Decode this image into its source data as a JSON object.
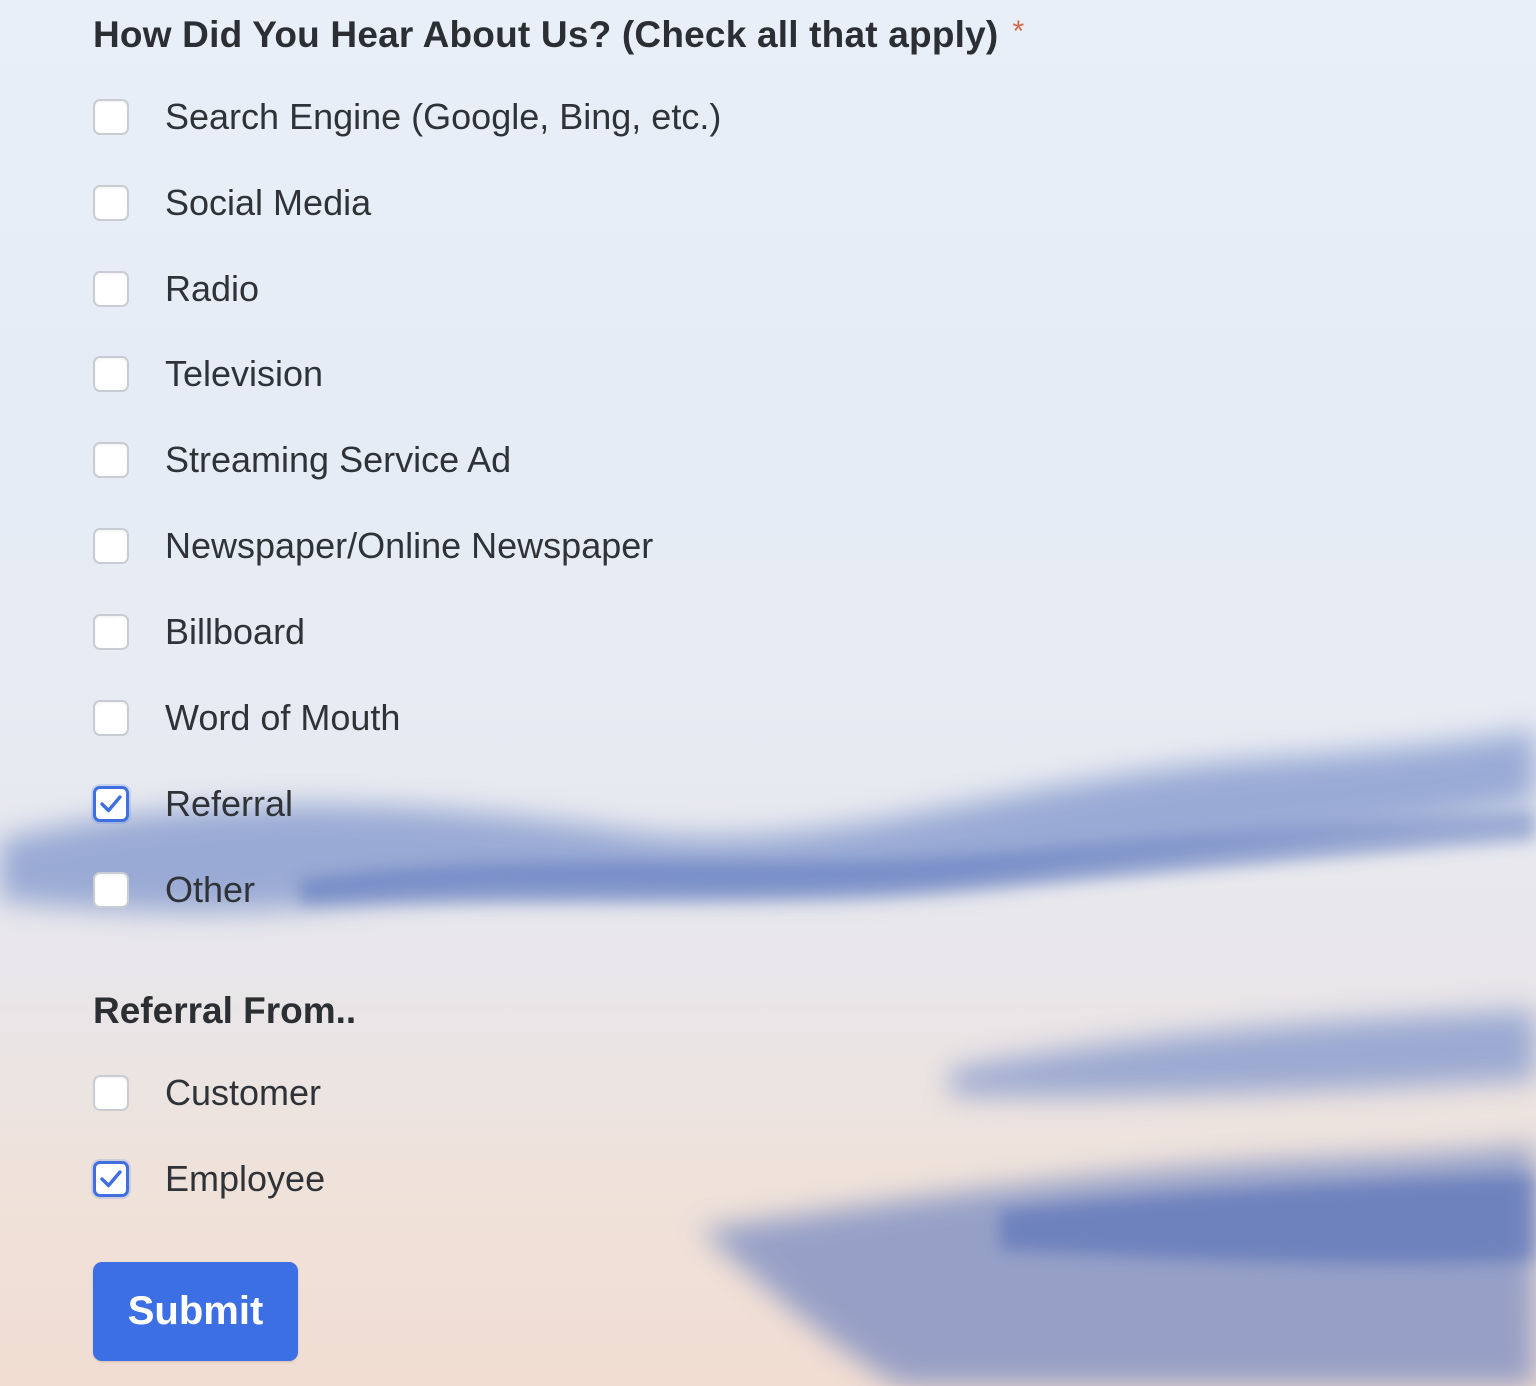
{
  "question": {
    "label": "How Did You Hear About Us? (Check all that apply)",
    "required_mark": "*",
    "options": [
      {
        "label": "Search Engine (Google, Bing, etc.)",
        "checked": false
      },
      {
        "label": "Social Media",
        "checked": false
      },
      {
        "label": "Radio",
        "checked": false
      },
      {
        "label": "Television",
        "checked": false
      },
      {
        "label": "Streaming Service Ad",
        "checked": false
      },
      {
        "label": "Newspaper/Online Newspaper",
        "checked": false
      },
      {
        "label": "Billboard",
        "checked": false
      },
      {
        "label": "Word of Mouth",
        "checked": false
      },
      {
        "label": "Referral",
        "checked": true
      },
      {
        "label": "Other",
        "checked": false
      }
    ]
  },
  "referral": {
    "label": "Referral From..",
    "options": [
      {
        "label": "Customer",
        "checked": false
      },
      {
        "label": "Employee",
        "checked": true
      }
    ]
  },
  "submit": {
    "label": "Submit"
  },
  "colors": {
    "accent": "#3b6fe3",
    "required": "#d2694a",
    "text": "#2f3338"
  }
}
